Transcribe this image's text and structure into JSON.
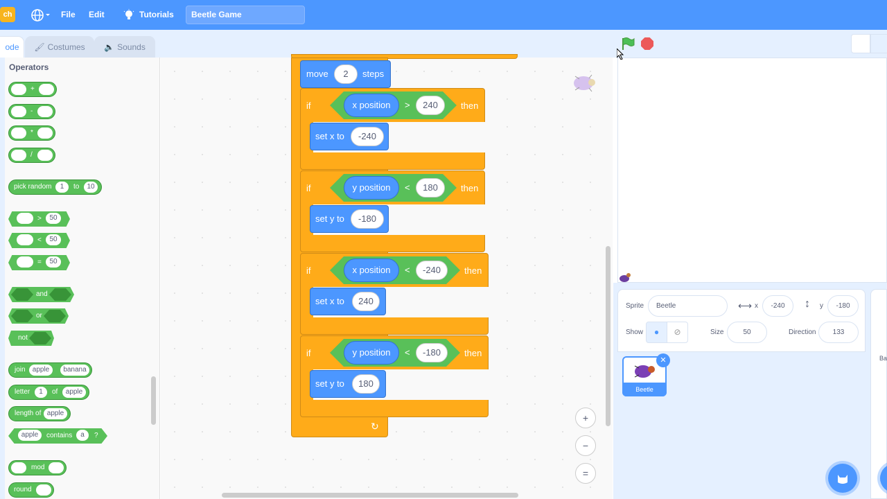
{
  "menubar": {
    "logo_text": "ch",
    "file_label": "File",
    "edit_label": "Edit",
    "tutorials_label": "Tutorials",
    "project_title": "Beetle Game"
  },
  "tabs": {
    "code": "ode",
    "costumes": "Costumes",
    "sounds": "Sounds"
  },
  "palette": {
    "category": "Operators",
    "add": "+",
    "sub": "-",
    "mul": "*",
    "div": "/",
    "pick_random": "pick random",
    "pick_from": "1",
    "pick_to_word": "to",
    "pick_to": "10",
    "gt": ">",
    "lt": "<",
    "eq": "=",
    "cmp_value": "50",
    "and": "and",
    "or": "or",
    "not": "not",
    "join": "join",
    "join_a": "apple",
    "join_b": "banana",
    "letter": "letter",
    "letter_n": "1",
    "letter_of": "of",
    "letter_word": "apple",
    "length_of": "length of",
    "length_word": "apple",
    "contains_word": "apple",
    "contains": "contains",
    "contains_letter": "a",
    "contains_q": "?",
    "mod": "mod",
    "round": "round"
  },
  "script": {
    "move": "move",
    "move_steps": "2",
    "steps": "steps",
    "if": "if",
    "then": "then",
    "x_position": "x position",
    "y_position": "y position",
    "gt": ">",
    "lt": "<",
    "cond1_value": "240",
    "cond2_value": "180",
    "cond3_value": "-240",
    "cond4_value": "-180",
    "set_x_to": "set x to",
    "set_y_to": "set y to",
    "set1_value": "-240",
    "set2_value": "-180",
    "set3_value": "240",
    "set4_value": "180"
  },
  "zoom": {
    "zoom_in": "+",
    "zoom_out": "−",
    "reset": "="
  },
  "sprite_info": {
    "sprite_label": "Sprite",
    "sprite_name": "Beetle",
    "x_label": "x",
    "x_value": "-240",
    "y_label": "y",
    "y_value": "-180",
    "show_label": "Show",
    "size_label": "Size",
    "size_value": "50",
    "direction_label": "Direction",
    "direction_value": "133"
  },
  "sprites": [
    {
      "name": "Beetle"
    }
  ],
  "backdrop_partial": "Ba",
  "colors": {
    "menubar": "#4c97ff",
    "control": "#ffab19",
    "motion": "#4c97ff",
    "operators": "#59c059"
  }
}
